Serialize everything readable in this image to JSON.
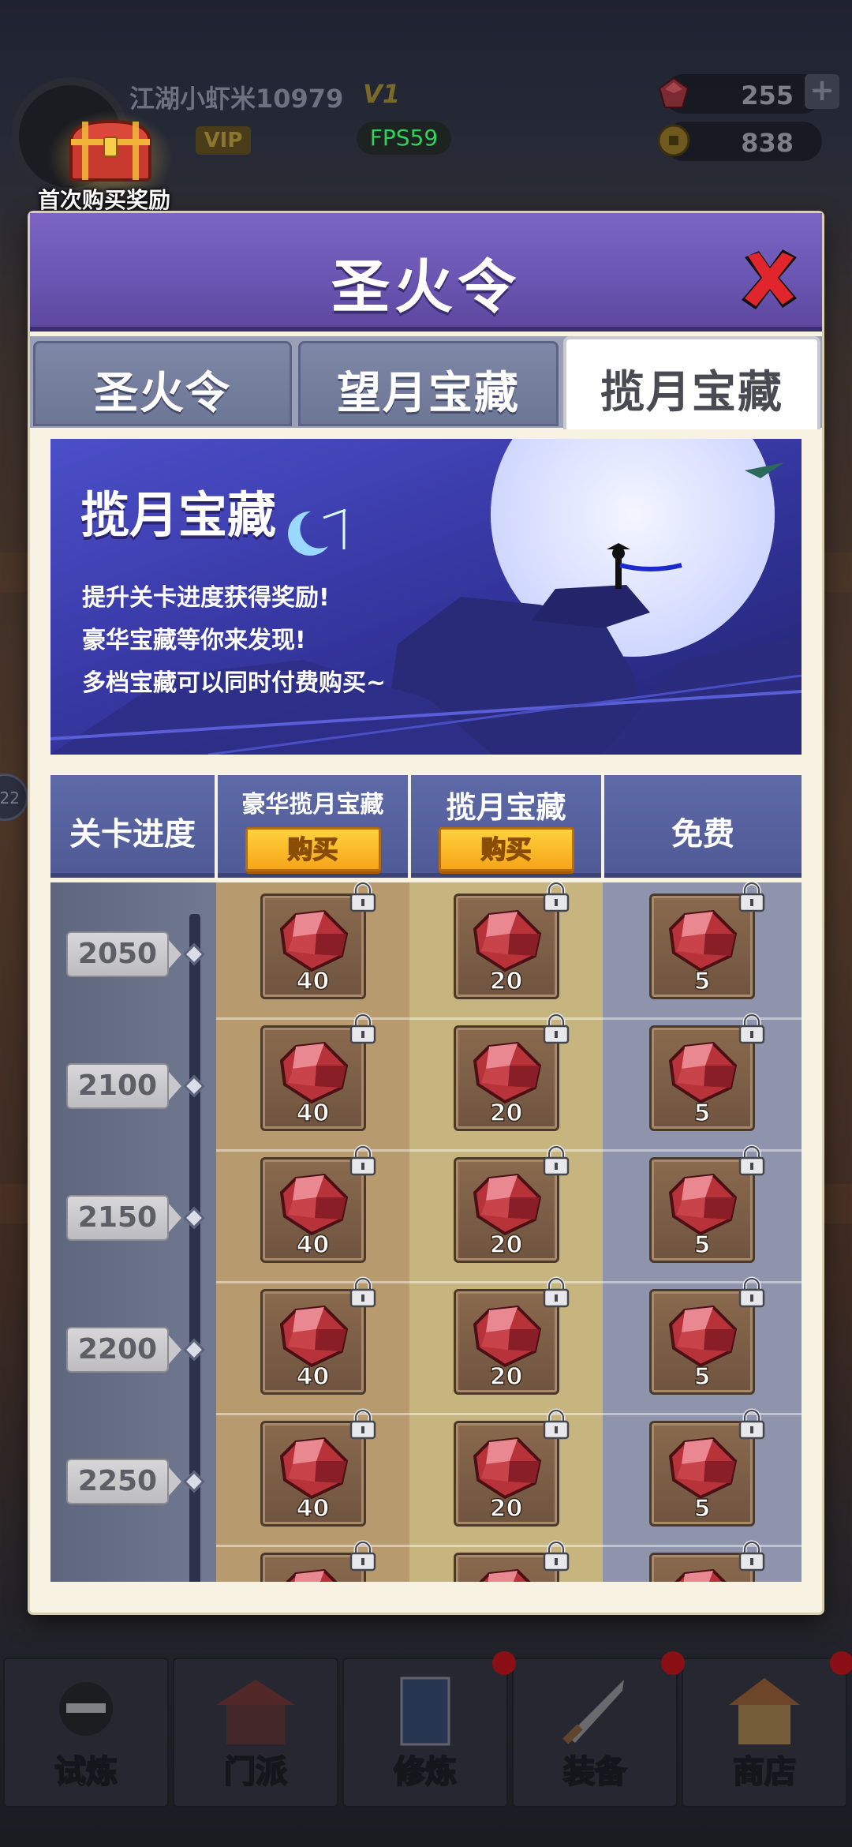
{
  "hud": {
    "player_name": "江湖小虾米10979",
    "vip_level": "V1",
    "vip_label": "VIP",
    "fps": "FPS59",
    "gems": "255",
    "gold": "838",
    "first_purchase_label": "首次购买奖励",
    "side_marker": "22"
  },
  "modal": {
    "title": "圣火令",
    "tabs": [
      {
        "label": "圣火令",
        "active": false
      },
      {
        "label": "望月宝藏",
        "active": false
      },
      {
        "label": "揽月宝藏",
        "active": true
      }
    ]
  },
  "banner": {
    "title": "揽月宝藏",
    "lines": [
      "提升关卡进度获得奖励!",
      "豪华宝藏等你来发现!",
      "多档宝藏可以同时付费购买~"
    ]
  },
  "table": {
    "headers": {
      "progress": "关卡进度",
      "luxury": "豪华揽月宝藏",
      "standard": "揽月宝藏",
      "free": "免费"
    },
    "buy_label": "购买",
    "rows": [
      {
        "level": "2050",
        "luxury": "40",
        "standard": "20",
        "free": "5"
      },
      {
        "level": "2100",
        "luxury": "40",
        "standard": "20",
        "free": "5"
      },
      {
        "level": "2150",
        "luxury": "40",
        "standard": "20",
        "free": "5"
      },
      {
        "level": "2200",
        "luxury": "40",
        "standard": "20",
        "free": "5"
      },
      {
        "level": "2250",
        "luxury": "40",
        "standard": "20",
        "free": "5"
      }
    ]
  },
  "bottom_nav": [
    {
      "label": "试炼",
      "icon": "ninja-icon"
    },
    {
      "label": "门派",
      "icon": "temple-icon"
    },
    {
      "label": "修炼",
      "icon": "book-icon"
    },
    {
      "label": "装备",
      "icon": "sword-icon"
    },
    {
      "label": "商店",
      "icon": "shop-icon"
    }
  ],
  "colors": {
    "header_purple": "#6a55b2",
    "buy_gold": "#f6a51a",
    "fps_green": "#2fd35a"
  }
}
